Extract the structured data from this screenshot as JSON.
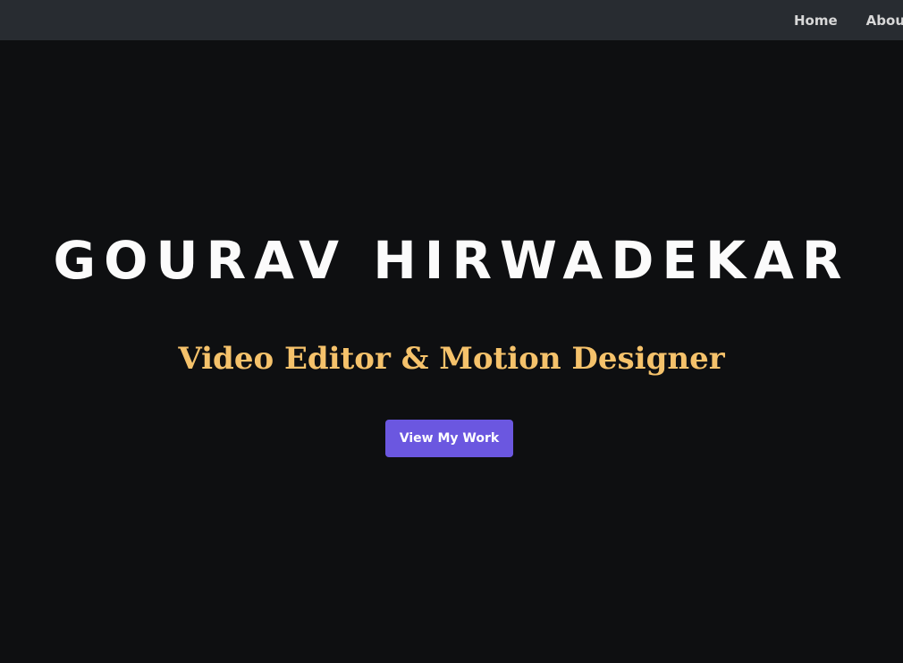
{
  "nav": {
    "links": [
      {
        "label": "Home"
      },
      {
        "label": "About"
      }
    ]
  },
  "hero": {
    "title": "GOURAV HIRWADEKAR",
    "subtitle": "Video Editor & Motion Designer",
    "cta_label": "View My Work"
  },
  "colors": {
    "background": "#0e0f11",
    "navbar": "#282c31",
    "accent_subtitle": "#f5c26b",
    "button": "#6b57e0"
  }
}
